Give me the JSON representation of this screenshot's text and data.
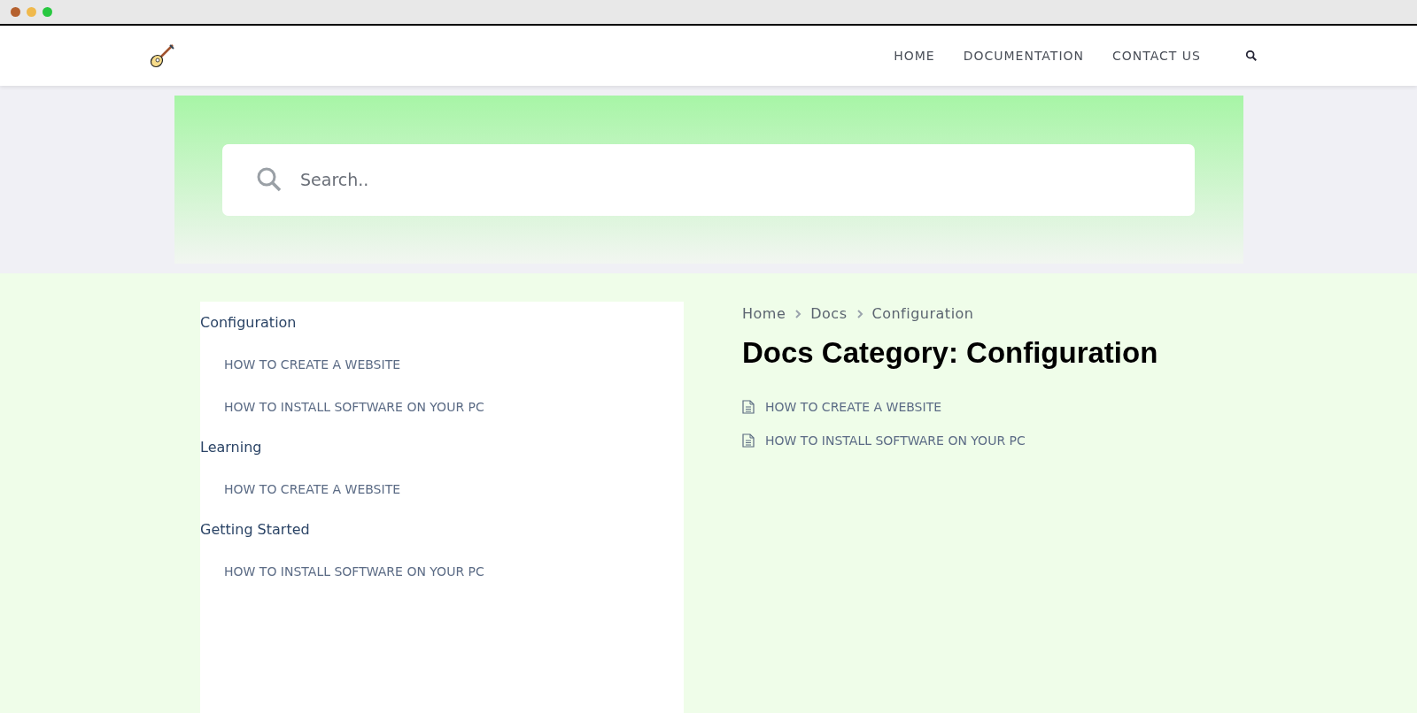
{
  "nav": {
    "items": [
      "HOME",
      "DOCUMENTATION",
      "CONTACT US"
    ]
  },
  "search": {
    "placeholder": "Search.."
  },
  "sidebar": {
    "sections": [
      {
        "title": "Configuration",
        "items": [
          "HOW TO CREATE A WEBSITE",
          "HOW TO INSTALL SOFTWARE ON YOUR PC"
        ]
      },
      {
        "title": "Learning",
        "items": [
          "HOW TO CREATE A WEBSITE"
        ]
      },
      {
        "title": "Getting Started",
        "items": [
          "HOW TO INSTALL SOFTWARE ON YOUR PC"
        ]
      }
    ]
  },
  "breadcrumb": [
    "Home",
    "Docs",
    "Configuration"
  ],
  "heading": "Docs Category: Configuration",
  "docs": [
    "HOW TO CREATE A WEBSITE",
    "HOW TO INSTALL SOFTWARE ON YOUR PC"
  ]
}
